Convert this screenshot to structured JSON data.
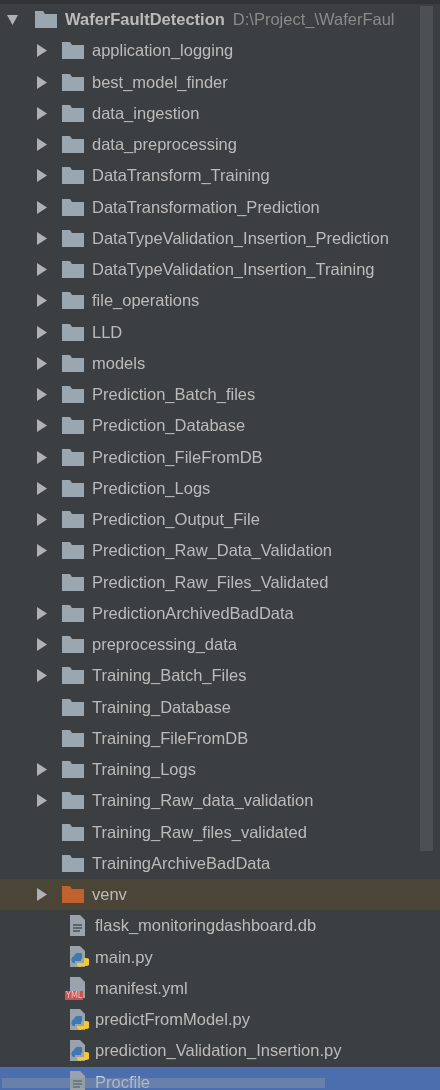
{
  "root": {
    "name": "WaferFaultDetection",
    "path": "D:\\Project_\\WaferFaul",
    "expanded": true
  },
  "items": [
    {
      "kind": "folder",
      "name": "application_logging",
      "expandable": true,
      "excluded": false,
      "selected": false
    },
    {
      "kind": "folder",
      "name": "best_model_finder",
      "expandable": true,
      "excluded": false,
      "selected": false
    },
    {
      "kind": "folder",
      "name": "data_ingestion",
      "expandable": true,
      "excluded": false,
      "selected": false
    },
    {
      "kind": "folder",
      "name": "data_preprocessing",
      "expandable": true,
      "excluded": false,
      "selected": false
    },
    {
      "kind": "folder",
      "name": "DataTransform_Training",
      "expandable": true,
      "excluded": false,
      "selected": false
    },
    {
      "kind": "folder",
      "name": "DataTransformation_Prediction",
      "expandable": true,
      "excluded": false,
      "selected": false
    },
    {
      "kind": "folder",
      "name": "DataTypeValidation_Insertion_Prediction",
      "expandable": true,
      "excluded": false,
      "selected": false
    },
    {
      "kind": "folder",
      "name": "DataTypeValidation_Insertion_Training",
      "expandable": true,
      "excluded": false,
      "selected": false
    },
    {
      "kind": "folder",
      "name": "file_operations",
      "expandable": true,
      "excluded": false,
      "selected": false
    },
    {
      "kind": "folder",
      "name": "LLD",
      "expandable": true,
      "excluded": false,
      "selected": false
    },
    {
      "kind": "folder",
      "name": "models",
      "expandable": true,
      "excluded": false,
      "selected": false
    },
    {
      "kind": "folder",
      "name": "Prediction_Batch_files",
      "expandable": true,
      "excluded": false,
      "selected": false
    },
    {
      "kind": "folder",
      "name": "Prediction_Database",
      "expandable": true,
      "excluded": false,
      "selected": false
    },
    {
      "kind": "folder",
      "name": "Prediction_FileFromDB",
      "expandable": true,
      "excluded": false,
      "selected": false
    },
    {
      "kind": "folder",
      "name": "Prediction_Logs",
      "expandable": true,
      "excluded": false,
      "selected": false
    },
    {
      "kind": "folder",
      "name": "Prediction_Output_File",
      "expandable": true,
      "excluded": false,
      "selected": false
    },
    {
      "kind": "folder",
      "name": "Prediction_Raw_Data_Validation",
      "expandable": true,
      "excluded": false,
      "selected": false
    },
    {
      "kind": "folder",
      "name": "Prediction_Raw_Files_Validated",
      "expandable": false,
      "excluded": false,
      "selected": false
    },
    {
      "kind": "folder",
      "name": "PredictionArchivedBadData",
      "expandable": true,
      "excluded": false,
      "selected": false
    },
    {
      "kind": "folder",
      "name": "preprocessing_data",
      "expandable": true,
      "excluded": false,
      "selected": false
    },
    {
      "kind": "folder",
      "name": "Training_Batch_Files",
      "expandable": true,
      "excluded": false,
      "selected": false
    },
    {
      "kind": "folder",
      "name": "Training_Database",
      "expandable": false,
      "excluded": false,
      "selected": false
    },
    {
      "kind": "folder",
      "name": "Training_FileFromDB",
      "expandable": false,
      "excluded": false,
      "selected": false
    },
    {
      "kind": "folder",
      "name": "Training_Logs",
      "expandable": true,
      "excluded": false,
      "selected": false
    },
    {
      "kind": "folder",
      "name": "Training_Raw_data_validation",
      "expandable": true,
      "excluded": false,
      "selected": false
    },
    {
      "kind": "folder",
      "name": "Training_Raw_files_validated",
      "expandable": false,
      "excluded": false,
      "selected": false
    },
    {
      "kind": "folder",
      "name": "TrainingArchiveBadData",
      "expandable": false,
      "excluded": false,
      "selected": false
    },
    {
      "kind": "folder",
      "name": "venv",
      "expandable": true,
      "excluded": true,
      "selected": false
    },
    {
      "kind": "text_file",
      "name": "flask_monitoringdashboard.db",
      "selected": false
    },
    {
      "kind": "python_file",
      "name": "main.py",
      "selected": false
    },
    {
      "kind": "yaml_file",
      "name": "manifest.yml",
      "badge": "YML",
      "selected": false
    },
    {
      "kind": "python_file",
      "name": "predictFromModel.py",
      "selected": false
    },
    {
      "kind": "python_file",
      "name": "prediction_Validation_Insertion.py",
      "selected": false
    },
    {
      "kind": "text_file",
      "name": "Procfile",
      "selected": true
    }
  ]
}
